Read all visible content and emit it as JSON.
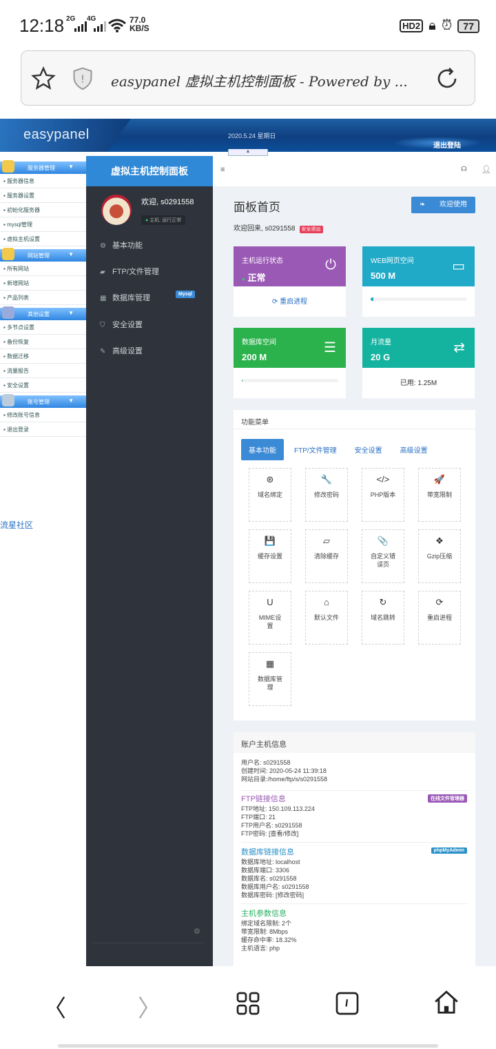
{
  "statusbar": {
    "time": "12:18",
    "net1": "2G",
    "net2": "4G",
    "speed_value": "77.0",
    "speed_unit": "KB/S",
    "hd": "HD2",
    "battery": "77"
  },
  "browser": {
    "page_title": "easypanel 虚拟主机控制面板 - Powered by ..."
  },
  "banner": {
    "logo": "easypanel",
    "date": "2020.5.24 星期日",
    "logout": "退出登陆"
  },
  "leftnav": {
    "groups": [
      {
        "title": "服务器管理",
        "items": [
          "服务器信息",
          "服务器设置",
          "初始化服务器",
          "mysql管理",
          "虚拟主机设置"
        ]
      },
      {
        "title": "网站管理",
        "items": [
          "所有网站",
          "新增网站",
          "产品列表"
        ]
      },
      {
        "title": "其他设置",
        "items": [
          "多节点设置",
          "备份恢复",
          "数据迁移",
          "流量报告",
          "安全设置"
        ]
      },
      {
        "title": "账号管理",
        "items": [
          "修改账号信息",
          "退出登录"
        ]
      }
    ],
    "community": "流星社区"
  },
  "sidebar": {
    "title": "虚拟主机控制面板",
    "welcome": "欢迎,  s0291558",
    "status": "主机: 运行正常",
    "menu": [
      "基本功能",
      "FTP/文件管理",
      "数据库管理",
      "安全设置",
      "高级设置"
    ],
    "mysql_badge": "Mysql"
  },
  "main": {
    "heading": "面板首页",
    "welcome_button": "欢迎使用",
    "welcome_text": "欢迎回来, s0291558",
    "safe_logout": "安全退出",
    "stats": [
      {
        "label": "主机运行状态",
        "value": "正常",
        "footer": "重启进程",
        "color": "#9b59b6"
      },
      {
        "label": "WEB网页空间",
        "value": "500 M",
        "color": "#21a9c8",
        "progress": 0.03
      },
      {
        "label": "数据库空间",
        "value": "200 M",
        "color": "#2bb24c",
        "progress": 0.01
      },
      {
        "label": "月流量",
        "value": "20 G",
        "footer": "已用: 1.25M",
        "color": "#13b3a0"
      }
    ],
    "func_title": "功能菜单",
    "tabs": [
      "基本功能",
      "FTP/文件管理",
      "安全设置",
      "高级设置"
    ],
    "tiles": [
      {
        "icon": "dribbble-icon",
        "glyph": "⊛",
        "label": "域名绑定"
      },
      {
        "icon": "wrench-icon",
        "glyph": "🔧",
        "label": "修改密码"
      },
      {
        "icon": "code-icon",
        "glyph": "</>",
        "label": "PHP版本"
      },
      {
        "icon": "rocket-icon",
        "glyph": "🚀",
        "label": "带宽限制"
      },
      {
        "icon": "save-icon",
        "glyph": "💾",
        "label": "缓存设置"
      },
      {
        "icon": "eraser-icon",
        "glyph": "▱",
        "label": "清除缓存"
      },
      {
        "icon": "paperclip-icon",
        "glyph": "📎",
        "label": "自定义错误页"
      },
      {
        "icon": "dropbox-icon",
        "glyph": "❖",
        "label": "Gzip压缩"
      },
      {
        "icon": "magnet-icon",
        "glyph": "U",
        "label": "MIME设置"
      },
      {
        "icon": "home-icon",
        "glyph": "⌂",
        "label": "默认文件"
      },
      {
        "icon": "redo-icon",
        "glyph": "↻",
        "label": "域名跳转"
      },
      {
        "icon": "refresh-icon",
        "glyph": "⟳",
        "label": "重启进程"
      },
      {
        "icon": "table-icon",
        "glyph": "▦",
        "label": "数据库管理"
      }
    ],
    "account": {
      "title": "账户主机信息",
      "lines": [
        "用户名: s0291558",
        "创建时间: 2020-05-24 11:39:18",
        "网站目录:/home/ftp/s/s0291558"
      ],
      "ftp": {
        "title": "FTP链接信息",
        "badge": "在线文件管理器",
        "lines": [
          "FTP地址: 150.109.113.224",
          "FTP端口: 21",
          "FTP用户名: s0291558",
          "FTP密码: [查看/修改]"
        ]
      },
      "db": {
        "title": "数据库链接信息",
        "badge": "phpMyAdmin",
        "lines": [
          "数据库地址: localhost",
          "数据库端口: 3306",
          "数据库名: s0291558",
          "数据库用户名: s0291558",
          "数据库密码: [修改密码]"
        ]
      },
      "host": {
        "title": "主机参数信息",
        "lines": [
          "绑定域名限制: 2个",
          "带宽限制: 8Mbps",
          "缓存命中率: 18.32%",
          "主机语言: php"
        ]
      }
    }
  }
}
